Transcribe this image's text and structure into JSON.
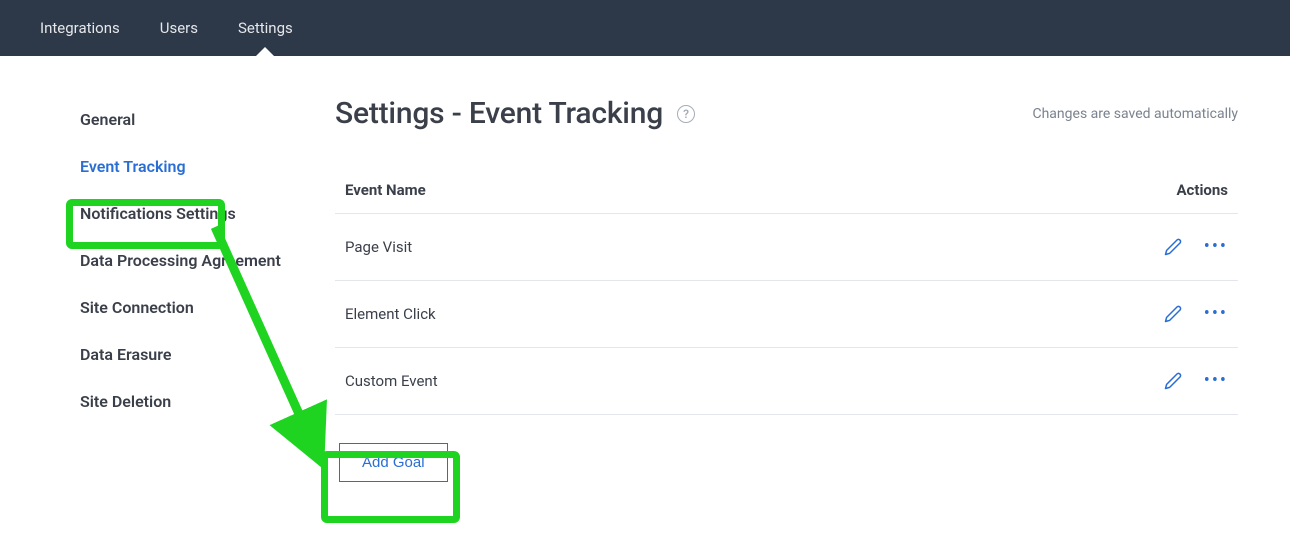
{
  "topnav": {
    "items": [
      {
        "label": "Integrations",
        "active": false
      },
      {
        "label": "Users",
        "active": false
      },
      {
        "label": "Settings",
        "active": true
      }
    ]
  },
  "sidebar": {
    "items": [
      {
        "label": "General",
        "active": false
      },
      {
        "label": "Event Tracking",
        "active": true
      },
      {
        "label": "Notifications Settings",
        "active": false
      },
      {
        "label": "Data Processing Agreement",
        "active": false
      },
      {
        "label": "Site Connection",
        "active": false
      },
      {
        "label": "Data Erasure",
        "active": false
      },
      {
        "label": "Site Deletion",
        "active": false
      }
    ]
  },
  "heading": {
    "title": "Settings - Event Tracking",
    "autosave_text": "Changes are saved automatically"
  },
  "table": {
    "header_name": "Event Name",
    "header_actions": "Actions",
    "rows": [
      {
        "name": "Page Visit"
      },
      {
        "name": "Element Click"
      },
      {
        "name": "Custom Event"
      }
    ]
  },
  "buttons": {
    "add_goal": "Add Goal"
  },
  "colors": {
    "topnav_bg": "#2d3848",
    "accent": "#2a6ed4",
    "annotation": "#1fd421"
  }
}
